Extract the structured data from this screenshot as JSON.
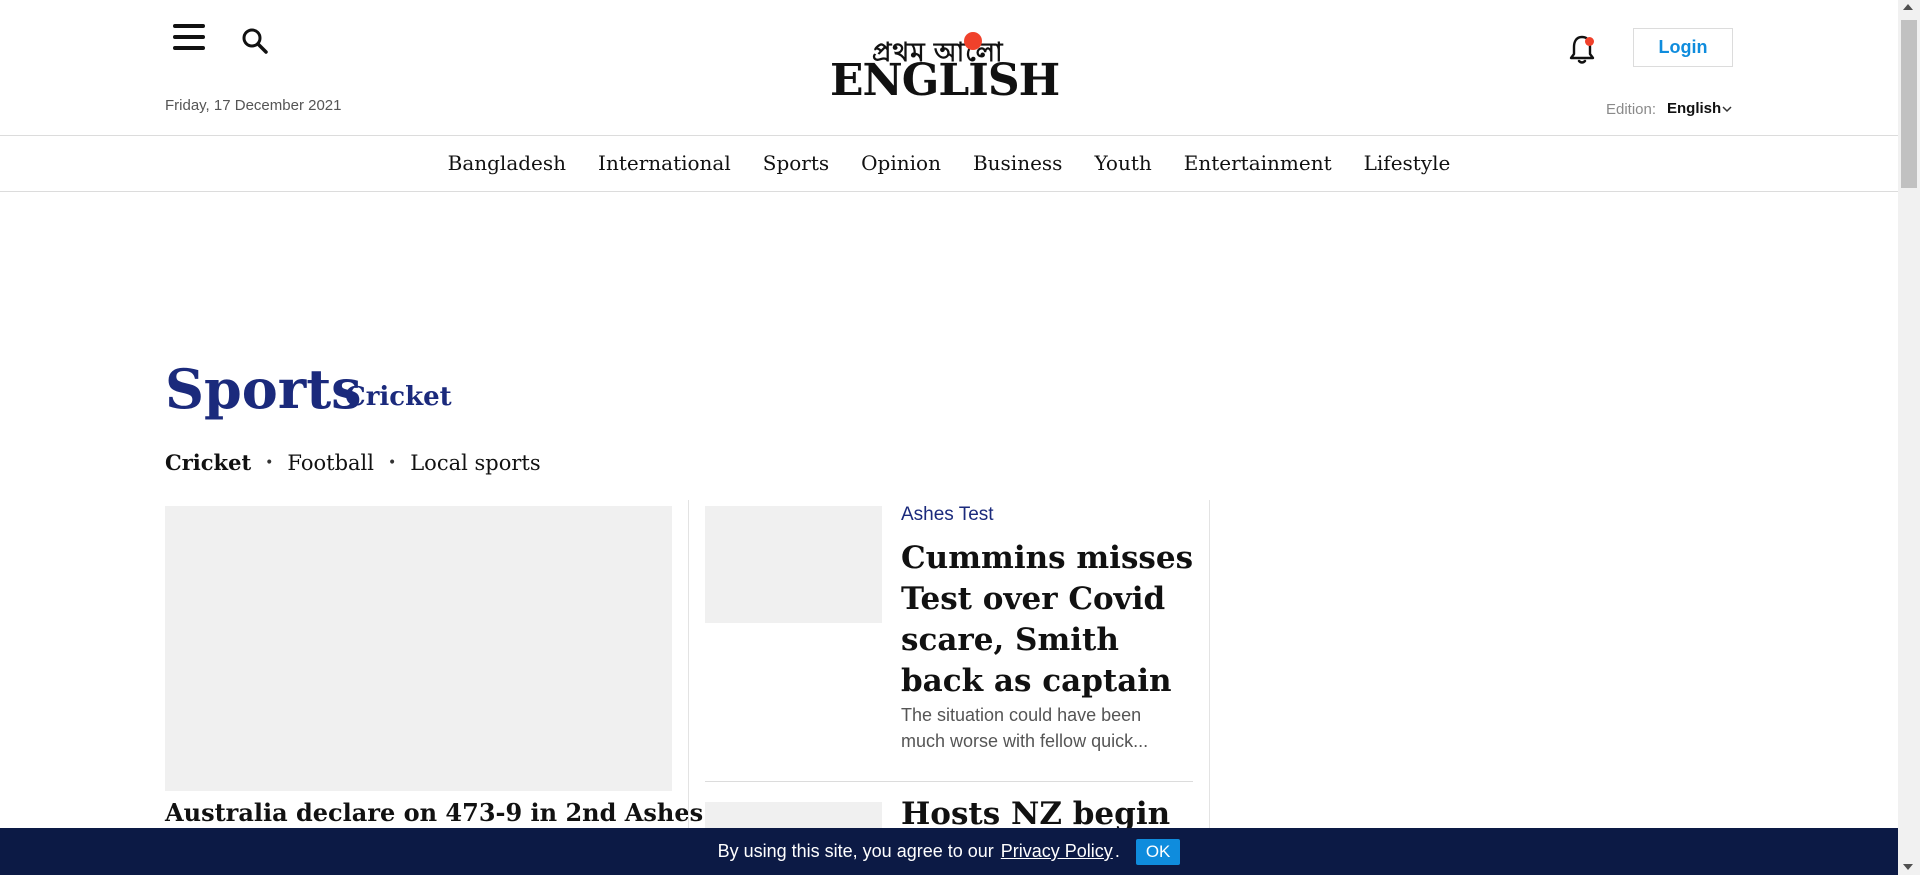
{
  "header": {
    "date": "Friday, 17 December 2021",
    "logo_bn": "প্রথম আলো",
    "logo_en": "ENGLISH",
    "login_label": "Login",
    "edition_label": "Edition:",
    "edition_value": "English",
    "accent_color": "#0f8cdd",
    "logo_sun_color": "#f0412b"
  },
  "nav": {
    "items": [
      "Bangladesh",
      "International",
      "Sports",
      "Opinion",
      "Business",
      "Youth",
      "Entertainment",
      "Lifestyle"
    ]
  },
  "section": {
    "title": "Sports",
    "subtitle": "Cricket",
    "title_color": "#1b2a7c",
    "subnav": [
      "Cricket",
      "Football",
      "Local sports"
    ]
  },
  "lead_story": {
    "title": "Australia declare on 473-9 in 2nd Ashes"
  },
  "stories": [
    {
      "kicker": "Ashes Test",
      "title": "Cummins misses Test over Covid scare, Smith back as captain",
      "summary_line1": "The situation could have been",
      "summary_line2": "much worse with fellow quick..."
    },
    {
      "title": "Hosts NZ begin"
    }
  ],
  "cookie_bar": {
    "text": "By using this site, you agree to our",
    "link": "Privacy Policy",
    "period": ".",
    "ok_label": "OK",
    "bg_color": "#0c1a45"
  },
  "icons": {
    "menu": "menu-icon",
    "search": "search-icon",
    "bell": "bell-icon",
    "chevron": "chevron-down-icon"
  }
}
